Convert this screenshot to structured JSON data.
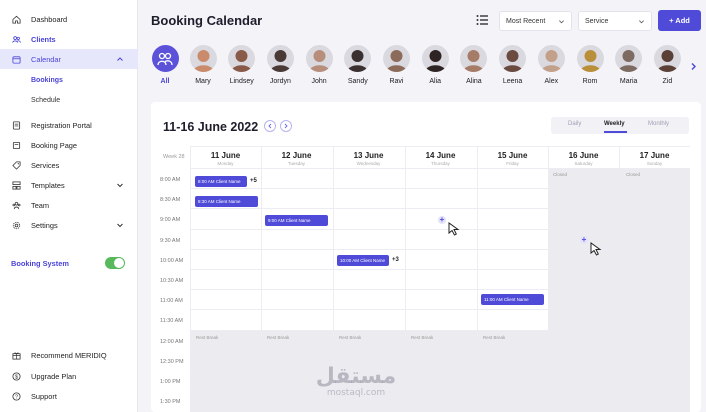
{
  "sidebar": {
    "items": [
      {
        "label": "Dashboard",
        "icon": "home-icon"
      },
      {
        "label": "Clients",
        "icon": "users-icon"
      },
      {
        "label": "Calendar",
        "icon": "calendar-icon"
      },
      {
        "label": "Registration Portal",
        "icon": "registration-icon"
      },
      {
        "label": "Booking Page",
        "icon": "book-icon"
      },
      {
        "label": "Services",
        "icon": "tag-icon"
      },
      {
        "label": "Templates",
        "icon": "templates-icon"
      },
      {
        "label": "Team",
        "icon": "team-icon"
      },
      {
        "label": "Settings",
        "icon": "gear-icon"
      },
      {
        "label": "Recommend MERIDIQ",
        "icon": "recommend-icon"
      },
      {
        "label": "Upgrade Plan",
        "icon": "dollar-icon"
      },
      {
        "label": "Support",
        "icon": "help-icon"
      }
    ],
    "calendar_sub": [
      "Bookings",
      "Schedule"
    ],
    "booking_system_label": "Booking System",
    "booking_system_on": true
  },
  "header": {
    "title": "Booking Calendar",
    "sort_value": "Most Recent",
    "service_value": "Service",
    "add_label": "+ Add"
  },
  "staff": [
    "All",
    "Mary",
    "Lindsey",
    "Jordyn",
    "John",
    "Sandy",
    "Ravi",
    "Alia",
    "Alina",
    "Leena",
    "Alex",
    "Rom",
    "Maria",
    "Zid"
  ],
  "calendar": {
    "range_title": "11-16 June 2022",
    "views": [
      "Daily",
      "Weekly",
      "Monthly"
    ],
    "active_view": "Weekly",
    "week_label": "Week 28",
    "days": [
      {
        "date": "11 June",
        "weekday": "Monday"
      },
      {
        "date": "12 June",
        "weekday": "Tuesday"
      },
      {
        "date": "13 June",
        "weekday": "Wednesday"
      },
      {
        "date": "14 June",
        "weekday": "Thursday"
      },
      {
        "date": "15 June",
        "weekday": "Friday"
      },
      {
        "date": "16 June",
        "weekday": "Saturday"
      },
      {
        "date": "17 June",
        "weekday": "Sunday"
      }
    ],
    "times": [
      "8:00 AM",
      "8:30 AM",
      "9:00 AM",
      "9:30 AM",
      "10:00 AM",
      "10:30 AM",
      "11:00 AM",
      "11:30 AM",
      "12:00 AM",
      "12:30 PM",
      "1:00 PM",
      "1:30 PM"
    ],
    "closed_label": "Closed",
    "rest_label": "Rest Break",
    "events": [
      {
        "text": "8:00 AM Client Name",
        "more": "+5"
      },
      {
        "text": "8:30 AM Client Name",
        "more": ""
      },
      {
        "text": "9:00 AM Client Name",
        "more": ""
      },
      {
        "text": "10:00 AM Client Name",
        "more": "+3"
      },
      {
        "text": "11:00 AM Client Name",
        "more": ""
      }
    ]
  },
  "watermark": {
    "arabic": "مستقل",
    "latin": "mostaql.com"
  },
  "colors": {
    "accent": "#4f4ad8",
    "toggle_on": "#57b95c"
  }
}
